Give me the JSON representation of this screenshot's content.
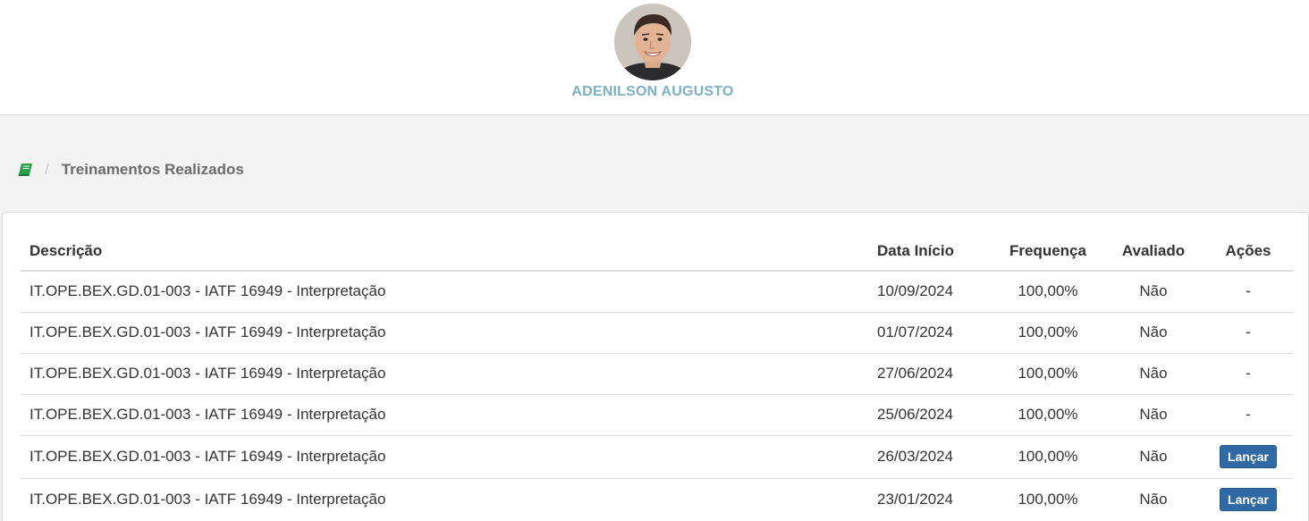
{
  "profile": {
    "name": "ADENILSON AUGUSTO"
  },
  "breadcrumb": {
    "icon": "book-icon",
    "separator": "/",
    "current": "Treinamentos Realizados"
  },
  "colors": {
    "name": "#7ab1c3",
    "icon": "#2a9d4a",
    "button": "#2f6aa4"
  },
  "table": {
    "headers": {
      "description": "Descrição",
      "start_date": "Data Início",
      "frequency": "Frequença",
      "evaluated": "Avaliado",
      "actions": "Ações"
    },
    "rows": [
      {
        "description": "IT.OPE.BEX.GD.01-003 - IATF 16949 - Interpretação",
        "start_date": "10/09/2024",
        "frequency": "100,00%",
        "evaluated": "Não",
        "action": "-"
      },
      {
        "description": "IT.OPE.BEX.GD.01-003 - IATF 16949 - Interpretação",
        "start_date": "01/07/2024",
        "frequency": "100,00%",
        "evaluated": "Não",
        "action": "-"
      },
      {
        "description": "IT.OPE.BEX.GD.01-003 - IATF 16949 - Interpretação",
        "start_date": "27/06/2024",
        "frequency": "100,00%",
        "evaluated": "Não",
        "action": "-"
      },
      {
        "description": "IT.OPE.BEX.GD.01-003 - IATF 16949 - Interpretação",
        "start_date": "25/06/2024",
        "frequency": "100,00%",
        "evaluated": "Não",
        "action": "-"
      },
      {
        "description": "IT.OPE.BEX.GD.01-003 - IATF 16949 - Interpretação",
        "start_date": "26/03/2024",
        "frequency": "100,00%",
        "evaluated": "Não",
        "action": "Lançar"
      },
      {
        "description": "IT.OPE.BEX.GD.01-003 - IATF 16949 - Interpretação",
        "start_date": "23/01/2024",
        "frequency": "100,00%",
        "evaluated": "Não",
        "action": "Lançar"
      }
    ]
  }
}
